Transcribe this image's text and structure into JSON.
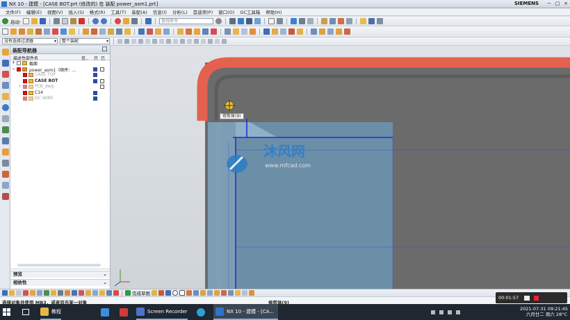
{
  "window": {
    "title": "NX 10 - 建模 - [CASE BOT.prt  (修改的)   在 装配 power_asm1.prt]",
    "brand": "SIEMENS",
    "controls": [
      "−",
      "□",
      "×"
    ]
  },
  "menu": [
    "文件(F)",
    "编辑(E)",
    "视图(V)",
    "插入(S)",
    "格式(R)",
    "工具(T)",
    "装配(A)",
    "信息(I)",
    "分析(L)",
    "首选项(P)",
    "窗口(O)",
    "GC工具箱",
    "帮助(H)"
  ],
  "toolbar": {
    "start_label": "启动·",
    "search_placeholder": "查找命令",
    "filter_value": "没有选择过滤器",
    "scope_value": "整个装配"
  },
  "navigator": {
    "title": "装配导航器",
    "col_name": "描述性部件名",
    "col_1": "信..",
    "col_2": "只",
    "col_3": "已",
    "items": [
      {
        "label": "截面",
        "checked": false,
        "grey": false,
        "indent": 0
      },
      {
        "label": "power_asm1（顺序：...",
        "checked": true,
        "grey": false,
        "indent": 0
      },
      {
        "label": "CASE TOP",
        "checked": true,
        "grey": true,
        "indent": 1
      },
      {
        "label": "CASE BOT",
        "checked": true,
        "grey": false,
        "indent": 1,
        "bold": true
      },
      {
        "label": "PCB_dwg",
        "checked": true,
        "grey": true,
        "indent": 1
      },
      {
        "label": "C14",
        "checked": true,
        "grey": false,
        "indent": 1
      },
      {
        "label": "DC WIRE",
        "checked": true,
        "grey": true,
        "indent": 1
      }
    ],
    "preview_label": "预览",
    "dependency_label": "相依性"
  },
  "graphics": {
    "tooltip": "修剪体(9)",
    "watermark_main": "沐风网",
    "watermark_url": "www.mfcad.com"
  },
  "cue_toolbar": {
    "finish_sketch": "完成草图"
  },
  "status": {
    "prompt": "选择对象并使用 MB3，或者双击某一对象",
    "feature": "修剪体(9)"
  },
  "timer": {
    "elapsed": "00:01:57"
  },
  "taskbar": {
    "apps": [
      "教程",
      "Screen Recorder",
      "NX 10 - 建模 - [CA..."
    ],
    "time": "2021-07-31 09:21:45",
    "date_weather": "六月廿二 周六 28°C"
  },
  "colors": {
    "case_red": "#e4604f",
    "body_blue": "#6c8fa8",
    "sketch_blue": "#1d2fd6",
    "graphics_bg": "#d3d8dd"
  }
}
